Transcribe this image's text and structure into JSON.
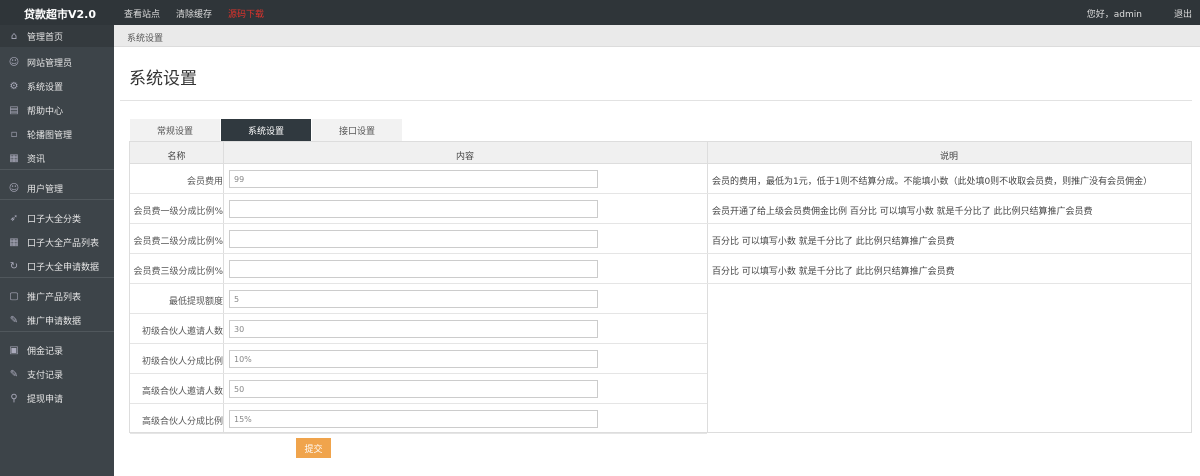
{
  "app": {
    "title": "贷款超市V2.0"
  },
  "topnav": [
    {
      "label": "查看站点",
      "danger": false
    },
    {
      "label": "清除缓存",
      "danger": false
    },
    {
      "label": "源码下载",
      "danger": true
    }
  ],
  "user": {
    "greeting": "您好，admin",
    "logout": "退出"
  },
  "sidebar": {
    "items": [
      {
        "label": "管理首页",
        "icon": "home-icon",
        "glyph": "⌂"
      },
      {
        "label": "网站管理员",
        "icon": "user-icon",
        "glyph": "☺"
      },
      {
        "label": "系统设置",
        "icon": "gear-icon",
        "glyph": "⚙"
      },
      {
        "label": "帮助中心",
        "icon": "help-icon",
        "glyph": "▤"
      },
      {
        "label": "轮播图管理",
        "icon": "image-icon",
        "glyph": "▫"
      },
      {
        "label": "资讯",
        "icon": "news-icon",
        "glyph": "▦"
      },
      {
        "label": "用户管理",
        "icon": "users-icon",
        "glyph": "☺"
      },
      {
        "label": "口子大全分类",
        "icon": "send-icon",
        "glyph": "➶"
      },
      {
        "label": "口子大全产品列表",
        "icon": "grid-icon",
        "glyph": "▦"
      },
      {
        "label": "口子大全申请数据",
        "icon": "refresh-icon",
        "glyph": "↻"
      },
      {
        "label": "推广产品列表",
        "icon": "list-icon",
        "glyph": "▢"
      },
      {
        "label": "推广申请数据",
        "icon": "edit-icon",
        "glyph": "✎"
      },
      {
        "label": "佣金记录",
        "icon": "wallet-icon",
        "glyph": "▣"
      },
      {
        "label": "支付记录",
        "icon": "pay-icon",
        "glyph": "✎"
      },
      {
        "label": "提现申请",
        "icon": "link-icon",
        "glyph": "⚲"
      }
    ]
  },
  "breadcrumb": "系统设置",
  "page_title": "系统设置",
  "tabs": [
    {
      "label": "常规设置",
      "active": false
    },
    {
      "label": "系统设置",
      "active": true
    },
    {
      "label": "接口设置",
      "active": false
    }
  ],
  "table": {
    "headers": {
      "name": "名称",
      "content": "内容",
      "desc": "说明"
    },
    "rows": [
      {
        "label": "会员费用",
        "value": "99",
        "placeholder": ""
      },
      {
        "label": "会员费一级分成比例%",
        "value": "",
        "placeholder": ""
      },
      {
        "label": "会员费二级分成比例%",
        "value": "",
        "placeholder": ""
      },
      {
        "label": "会员费三级分成比例%",
        "value": "",
        "placeholder": ""
      },
      {
        "label": "最低提现额度",
        "value": "5",
        "placeholder": ""
      },
      {
        "label": "初级合伙人邀请人数",
        "value": "30",
        "placeholder": ""
      },
      {
        "label": "初级合伙人分成比例",
        "value": "10%",
        "placeholder": ""
      },
      {
        "label": "高级合伙人邀请人数",
        "value": "50",
        "placeholder": ""
      },
      {
        "label": "高级合伙人分成比例",
        "value": "15%",
        "placeholder": ""
      }
    ],
    "descriptions": [
      "会员的费用，最低为1元，低于1则不结算分成。不能填小数（此处填0则不收取会员费，则推广没有会员佣金）",
      "会员开通了给上级会员费佣金比例 百分比 可以填写小数 就是千分比了 此比例只结算推广会员费",
      "百分比 可以填写小数 就是千分比了 此比例只结算推广会员费",
      "百分比 可以填写小数 就是千分比了 此比例只结算推广会员费"
    ]
  },
  "submit_label": "提交"
}
